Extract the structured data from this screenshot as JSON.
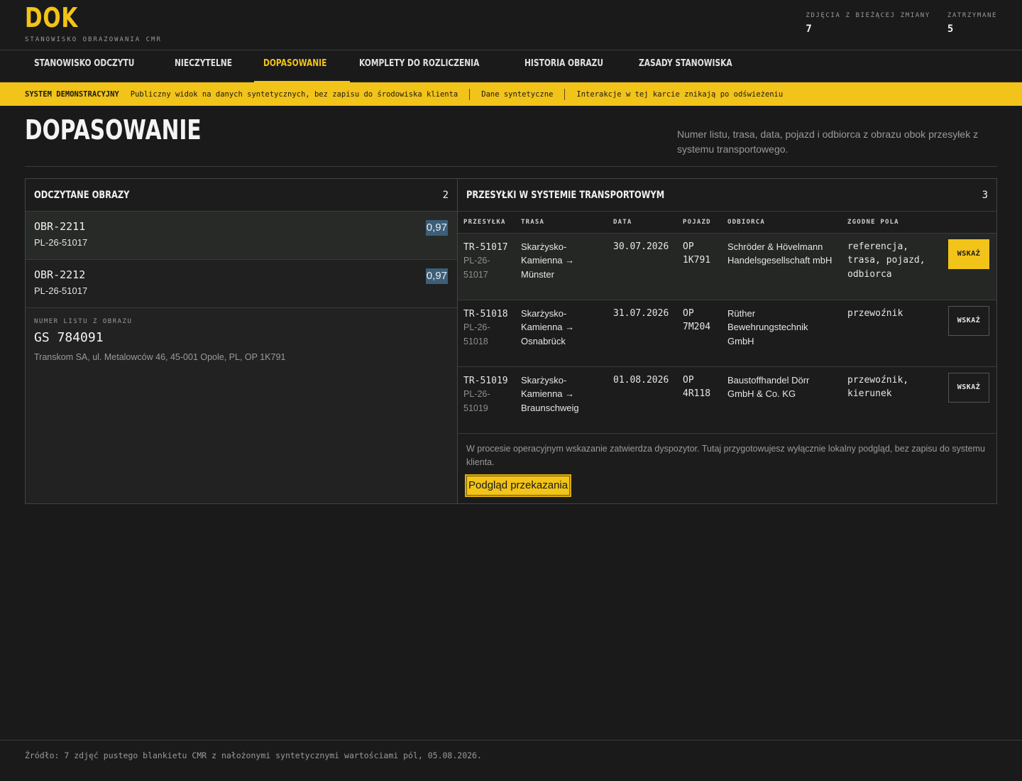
{
  "brand": {
    "logo": "DOK",
    "subtitle": "STANOWISKO OBRAZOWANIA CMR"
  },
  "stats": [
    {
      "label": "ZDJĘCIA Z BIEŻĄCEJ ZMIANY",
      "value": "7"
    },
    {
      "label": "ZATRZYMANE",
      "value": "5"
    }
  ],
  "nav": [
    {
      "label": "STANOWISKO ODCZYTU"
    },
    {
      "label": "NIECZYTELNE"
    },
    {
      "label": "DOPASOWANIE"
    },
    {
      "label": "KOMPLETY DO ROZLICZENIA"
    },
    {
      "label": "HISTORIA OBRAZU"
    },
    {
      "label": "ZASADY STANOWISKA"
    }
  ],
  "demo_bar": {
    "label": "SYSTEM DEMONSTRACYJNY",
    "items": [
      "Publiczny widok na danych syntetycznych, bez zapisu do środowiska klienta",
      "Dane syntetyczne",
      "Interakcje w tej karcie znikają po odświeżeniu"
    ]
  },
  "page": {
    "title": "DOPASOWANIE",
    "description": "Numer listu, trasa, data, pojazd i odbiorca z obrazu obok przesyłek z systemu transportowego."
  },
  "images_panel": {
    "title": "ODCZYTANE OBRAZY",
    "count": "2",
    "items": [
      {
        "id": "OBR-2211",
        "ref": "PL-26-51017",
        "score": "0,97"
      },
      {
        "id": "OBR-2212",
        "ref": "PL-26-51017",
        "score": "0,97"
      }
    ],
    "detail": {
      "label": "NUMER LISTU Z OBRAZU",
      "value": "GS 784091",
      "address": "Transkom SA, ul. Metalowców 46, 45-001 Opole, PL, OP 1K791"
    }
  },
  "shipments_panel": {
    "title": "PRZESYŁKI W SYSTEMIE TRANSPORTOWYM",
    "count": "3",
    "columns": [
      "PRZESYŁKA",
      "TRASA",
      "DATA",
      "POJAZD",
      "ODBIORCA",
      "ZGODNE POLA"
    ],
    "rows": [
      {
        "id": "TR-51017",
        "ref": "PL-26-51017",
        "route": "Skarżysko-Kamienna → Münster",
        "date": "30.07.2026",
        "vehicle": "OP 1K791",
        "recipient": "Schröder & Hövelmann Handelsgesellschaft mbH",
        "matching": "referencja, trasa, pojazd, odbiorca",
        "action": "WSKAŻ"
      },
      {
        "id": "TR-51018",
        "ref": "PL-26-51018",
        "route": "Skarżysko-Kamienna → Osnabrück",
        "date": "31.07.2026",
        "vehicle": "OP 7M204",
        "recipient": "Rüther Bewehrungstechnik GmbH",
        "matching": "przewoźnik",
        "action": "WSKAŻ"
      },
      {
        "id": "TR-51019",
        "ref": "PL-26-51019",
        "route": "Skarżysko-Kamienna → Braunschweig",
        "date": "01.08.2026",
        "vehicle": "OP 4R118",
        "recipient": "Baustoffhandel Dörr GmbH & Co. KG",
        "matching": "przewoźnik, kierunek",
        "action": "WSKAŻ"
      }
    ],
    "note": "W procesie operacyjnym wskazanie zatwierdza dyspozytor. Tutaj przygotowujesz wyłącznie lokalny podgląd, bez zapisu do systemu klienta.",
    "handover_button": "Podgląd przekazania"
  },
  "footer": "Źródło: 7 zdjęć pustego blankietu CMR z nałożonymi syntetycznymi wartościami pól, 05.08.2026.",
  "colors": {
    "accent": "#f2c318",
    "background": "#1a1a1a",
    "score_badge": "#3d5e78"
  }
}
